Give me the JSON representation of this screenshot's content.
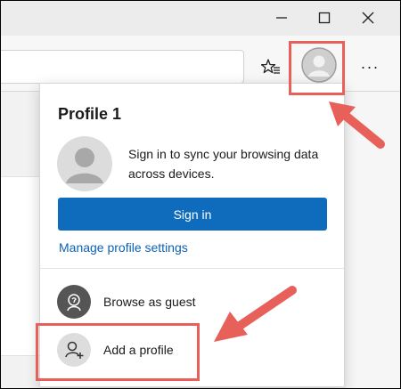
{
  "window": {
    "minimize_icon": "minimize-icon",
    "maximize_icon": "maximize-icon",
    "close_icon": "close-icon"
  },
  "toolbar": {
    "favorites_icon": "favorites-star-icon",
    "profile_icon": "profile-avatar-icon",
    "more_label": "···"
  },
  "profile_menu": {
    "title": "Profile 1",
    "sign_in_message": "Sign in to sync your browsing data across devices.",
    "sign_in_button": "Sign in",
    "manage_link": "Manage profile settings",
    "guest_label": "Browse as guest",
    "add_profile_label": "Add a profile"
  },
  "colors": {
    "accent": "#0f6cbd",
    "link": "#0b62b4",
    "highlight": "#e8605a"
  }
}
